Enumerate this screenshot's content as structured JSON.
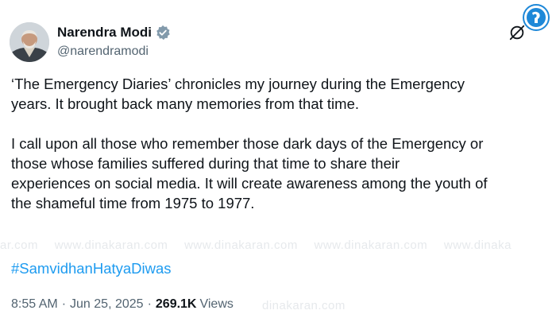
{
  "author": {
    "display_name": "Narendra Modi",
    "handle": "@narendramodi",
    "verified": true
  },
  "tweet": {
    "paragraphs": [
      [
        "‘The Emergency Diaries’ chronicles my journey during the Emergency",
        "years. It brought back many memories from that time."
      ],
      [
        "I call upon all those who remember those dark days of the Emergency or",
        "those whose families suffered during that time to share their",
        "experiences on social media. It will create awareness among the youth of",
        "the shameful time from 1975 to 1977."
      ]
    ],
    "hashtag": "#SamvidhanHatyaDiwas"
  },
  "meta": {
    "time": "8:55 AM",
    "date": "Jun 25, 2025",
    "views_count": "269.1K",
    "views_label": "Views"
  },
  "watermark": {
    "items": [
      "ar.com",
      "www.dinakaran.com",
      "www.dinakaran.com",
      "www.dinakaran.com",
      "www.dinaka"
    ],
    "inline": "dinakaran.com"
  },
  "colors": {
    "text": "#0f1419",
    "secondary": "#536471",
    "link": "#1d9bf0",
    "verified_badge": "#829aab",
    "logo_blue": "#1e88d8"
  },
  "icons": {
    "verified": "verified-badge-icon",
    "grok": "grok-icon",
    "site_logo": "site-logo-icon"
  }
}
